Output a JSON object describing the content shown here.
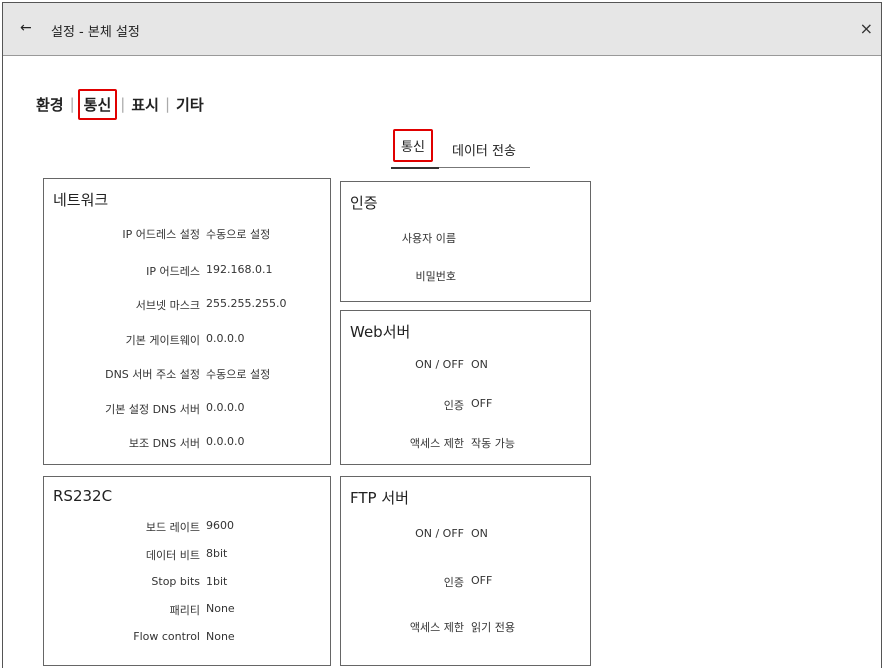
{
  "titlebar": {
    "back_icon": "←",
    "title": "설정 - 본체 설정",
    "close_icon": "×"
  },
  "category_tabs": [
    {
      "label": "환경",
      "active": false
    },
    {
      "label": "통신",
      "active": true
    },
    {
      "label": "표시",
      "active": false
    },
    {
      "label": "기타",
      "active": false
    }
  ],
  "sub_tabs": [
    {
      "label": "통신",
      "active": true
    },
    {
      "label": "데이터 전송",
      "active": false
    }
  ],
  "network": {
    "title": "네트워크",
    "rows": [
      {
        "label": "IP 어드레스 설정",
        "value": "수동으로 설정"
      },
      {
        "label": "IP 어드레스",
        "value": "192.168.0.1"
      },
      {
        "label": "서브넷 마스크",
        "value": "255.255.255.0"
      },
      {
        "label": "기본 게이트웨이",
        "value": "0.0.0.0"
      },
      {
        "label": "DNS 서버 주소 설정",
        "value": "수동으로 설정"
      },
      {
        "label": "기본 설정 DNS 서버",
        "value": "0.0.0.0"
      },
      {
        "label": "보조 DNS 서버",
        "value": "0.0.0.0"
      }
    ]
  },
  "auth": {
    "title": "인증",
    "rows": [
      {
        "label": "사용자 이름",
        "value": ""
      },
      {
        "label": "비밀번호",
        "value": ""
      }
    ]
  },
  "web": {
    "title": "Web서버",
    "rows": [
      {
        "label": "ON / OFF",
        "value": "ON"
      },
      {
        "label": "인증",
        "value": "OFF"
      },
      {
        "label": "액세스 제한",
        "value": "작동 가능"
      }
    ]
  },
  "rs232c": {
    "title": "RS232C",
    "rows": [
      {
        "label": "보드 레이트",
        "value": "9600"
      },
      {
        "label": "데이터 비트",
        "value": "8bit"
      },
      {
        "label": "Stop bits",
        "value": "1bit"
      },
      {
        "label": "패리티",
        "value": "None"
      },
      {
        "label": "Flow control",
        "value": "None"
      }
    ]
  },
  "ftp": {
    "title": "FTP 서버",
    "rows": [
      {
        "label": "ON / OFF",
        "value": "ON"
      },
      {
        "label": "인증",
        "value": "OFF"
      },
      {
        "label": "액세스 제한",
        "value": "읽기 전용"
      }
    ]
  }
}
